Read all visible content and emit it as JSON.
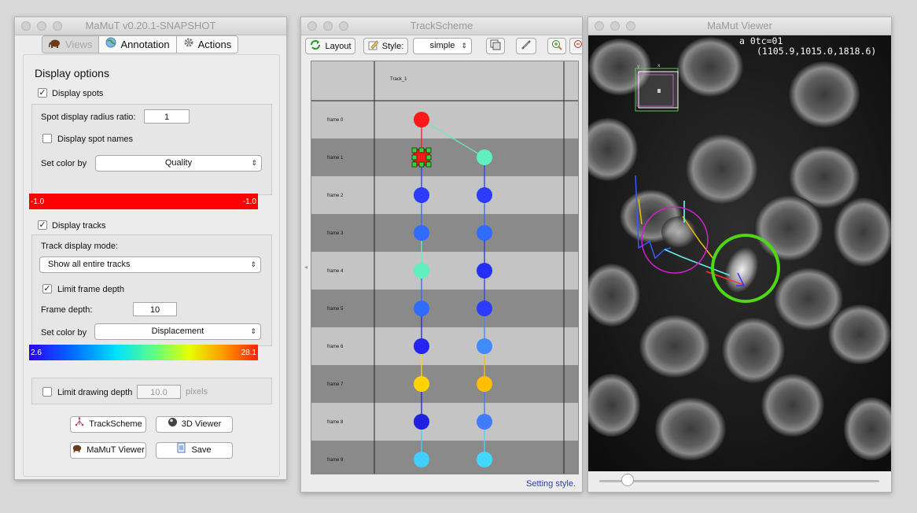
{
  "main_window": {
    "title": "MaMuT v0.20.1-SNAPSHOT",
    "tabs": [
      {
        "label": "Views",
        "icon": "elephant-icon",
        "active": true
      },
      {
        "label": "Annotation",
        "icon": "globe-icon",
        "active": false
      },
      {
        "label": "Actions",
        "icon": "gear-icon",
        "active": false
      }
    ],
    "section_title": "Display options",
    "display_spots": {
      "label": "Display spots",
      "checked": true
    },
    "spot_radius": {
      "label": "Spot display radius ratio:",
      "value": "1"
    },
    "display_spot_names": {
      "label": "Display spot names",
      "checked": false
    },
    "spot_color": {
      "label": "Set color by",
      "value": "Quality",
      "min": "-1.0",
      "max": "-1.0",
      "color": "#ff0000"
    },
    "display_tracks": {
      "label": "Display tracks",
      "checked": true
    },
    "track_mode": {
      "label": "Track display mode:",
      "value": "Show all entire tracks"
    },
    "limit_frame_depth": {
      "label": "Limit frame depth",
      "checked": true
    },
    "frame_depth": {
      "label": "Frame depth:",
      "value": "10"
    },
    "track_color": {
      "label": "Set color by",
      "value": "Displacement",
      "min": "2.6",
      "max": "28.1"
    },
    "limit_drawing_depth": {
      "label": "Limit drawing depth",
      "checked": false,
      "value": "10.0",
      "unit": "pixels"
    },
    "buttons": {
      "trackscheme": "TrackScheme",
      "viewer3d": "3D Viewer",
      "mamut_viewer": "MaMuT Viewer",
      "save": "Save"
    }
  },
  "trackscheme": {
    "title": "TrackScheme",
    "toolbar": {
      "layout": "Layout",
      "style_label": "Style:",
      "style_value": "simple"
    },
    "track_header": "Track_1",
    "frames": [
      "frame 0",
      "frame 1",
      "frame 2",
      "frame 3",
      "frame 4",
      "frame 5",
      "frame 6",
      "frame 7",
      "frame 8",
      "frame 9"
    ],
    "tracks": [
      {
        "spots": [
          {
            "frame": 0,
            "color": "#ff1a1a"
          },
          {
            "frame": 1,
            "color": "#ff1a1a",
            "selected": true
          },
          {
            "frame": 2,
            "color": "#2b3cff"
          },
          {
            "frame": 3,
            "color": "#2f6bff"
          },
          {
            "frame": 4,
            "color": "#5ff0c0"
          },
          {
            "frame": 5,
            "color": "#2f6bff"
          },
          {
            "frame": 6,
            "color": "#2424f0"
          },
          {
            "frame": 7,
            "color": "#ffd400"
          },
          {
            "frame": 8,
            "color": "#2020e0"
          },
          {
            "frame": 9,
            "color": "#40d0ff"
          }
        ]
      },
      {
        "spots": [
          {
            "frame": 1,
            "color": "#5ff0c0"
          },
          {
            "frame": 2,
            "color": "#2b3cff"
          },
          {
            "frame": 3,
            "color": "#2f6bff"
          },
          {
            "frame": 4,
            "color": "#2530f5"
          },
          {
            "frame": 5,
            "color": "#2b3cff"
          },
          {
            "frame": 6,
            "color": "#3f8aff"
          },
          {
            "frame": 7,
            "color": "#ffbf00"
          },
          {
            "frame": 8,
            "color": "#3f7aff"
          },
          {
            "frame": 9,
            "color": "#40d8ff"
          }
        ]
      }
    ],
    "status": "Setting style."
  },
  "viewer": {
    "title": "MaMut Viewer",
    "hud_line1": "a 0tc=01",
    "hud_line2": "(1105.9,1015.0,1818.6)",
    "time_slider_fraction": 0.1
  }
}
